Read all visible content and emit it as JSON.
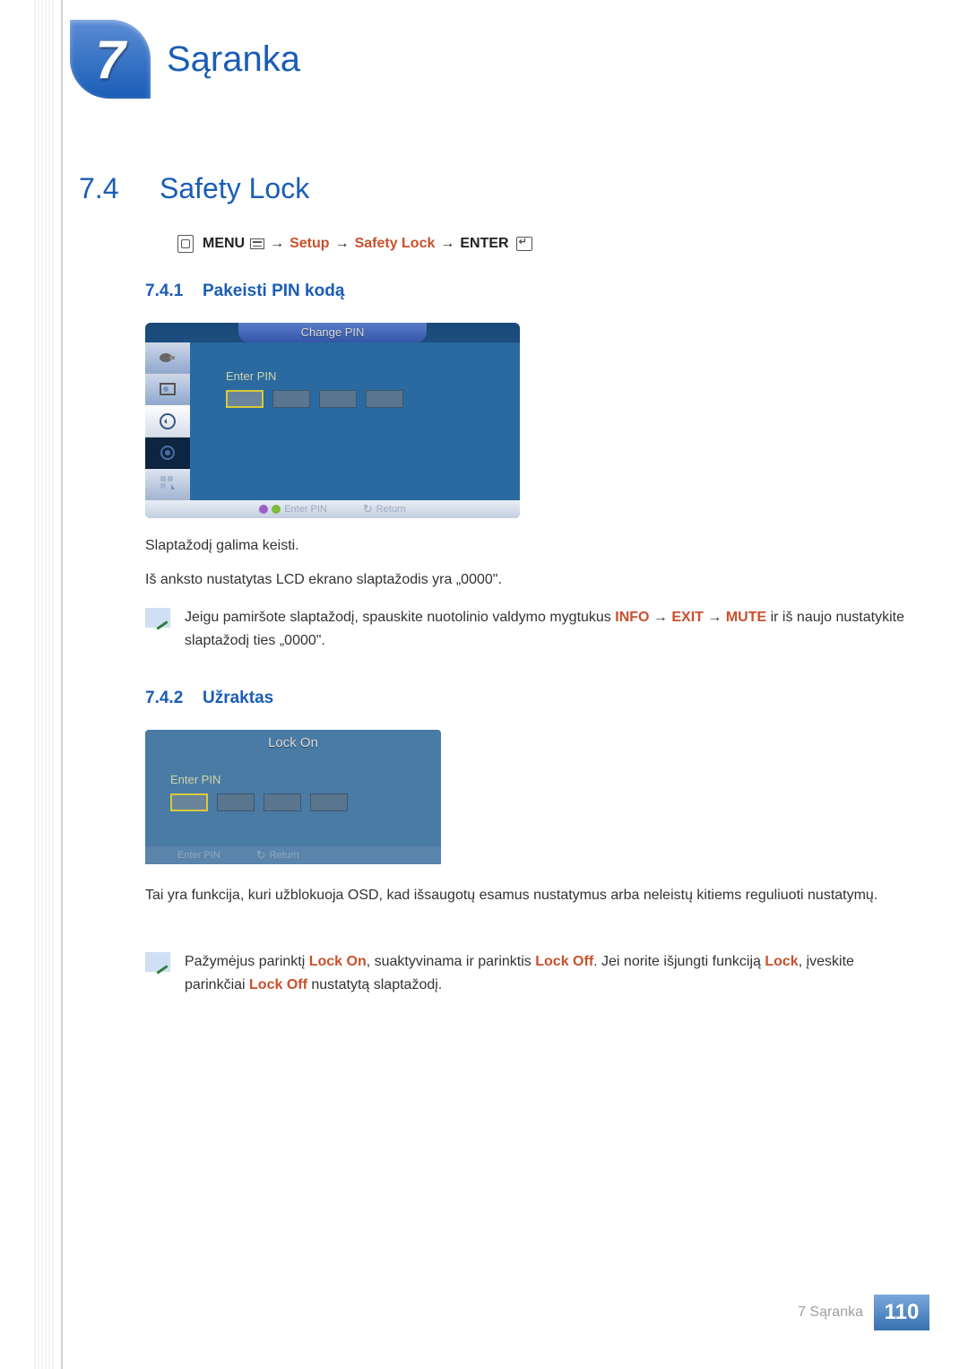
{
  "chapter": {
    "number": "7",
    "title": "Sąranka"
  },
  "section": {
    "number": "7.4",
    "title": "Safety Lock"
  },
  "breadcrumb": {
    "menu": "MENU",
    "arrow": "→",
    "setup": "Setup",
    "safety_lock": "Safety Lock",
    "enter": "ENTER"
  },
  "subsection1": {
    "number": "7.4.1",
    "title": "Pakeisti PIN kodą"
  },
  "osd1": {
    "title": "Change PIN",
    "enter_pin": "Enter PIN",
    "footer_enter": "Enter PIN",
    "footer_return": "Return"
  },
  "text1": "Slaptažodį galima keisti.",
  "text2": "Iš anksto nustatytas LCD ekrano slaptažodis yra „0000\".",
  "note1": {
    "prefix": "Jeigu pamiršote slaptažodį, spauskite nuotolinio valdymo mygtukus ",
    "info": "INFO",
    "arrow1": " → ",
    "exit": "EXIT",
    "arrow2": " → ",
    "mute": "MUTE",
    "suffix": " ir iš naujo nustatykite slaptažodį ties „0000\"."
  },
  "subsection2": {
    "number": "7.4.2",
    "title": "Užraktas"
  },
  "osd2": {
    "title": "Lock On",
    "enter_pin": "Enter PIN",
    "footer_enter": "Enter PIN",
    "footer_return": "Return"
  },
  "text3": "Tai yra funkcija, kuri užblokuoja OSD, kad išsaugotų esamus nustatymus arba neleistų kitiems reguliuoti nustatymų.",
  "note2": {
    "prefix": "Pažymėjus parinktį ",
    "lockon": "Lock On",
    "middle1": ", suaktyvinama ir parinktis ",
    "lockoff1": "Lock Off",
    "middle2": ". Jei norite išjungti funkciją ",
    "lock": "Lock",
    "middle3": ", įveskite parinkčiai ",
    "lockoff2": "Lock Off",
    "suffix": " nustatytą slaptažodį."
  },
  "footer": {
    "label": "7 Sąranka",
    "page": "110"
  }
}
